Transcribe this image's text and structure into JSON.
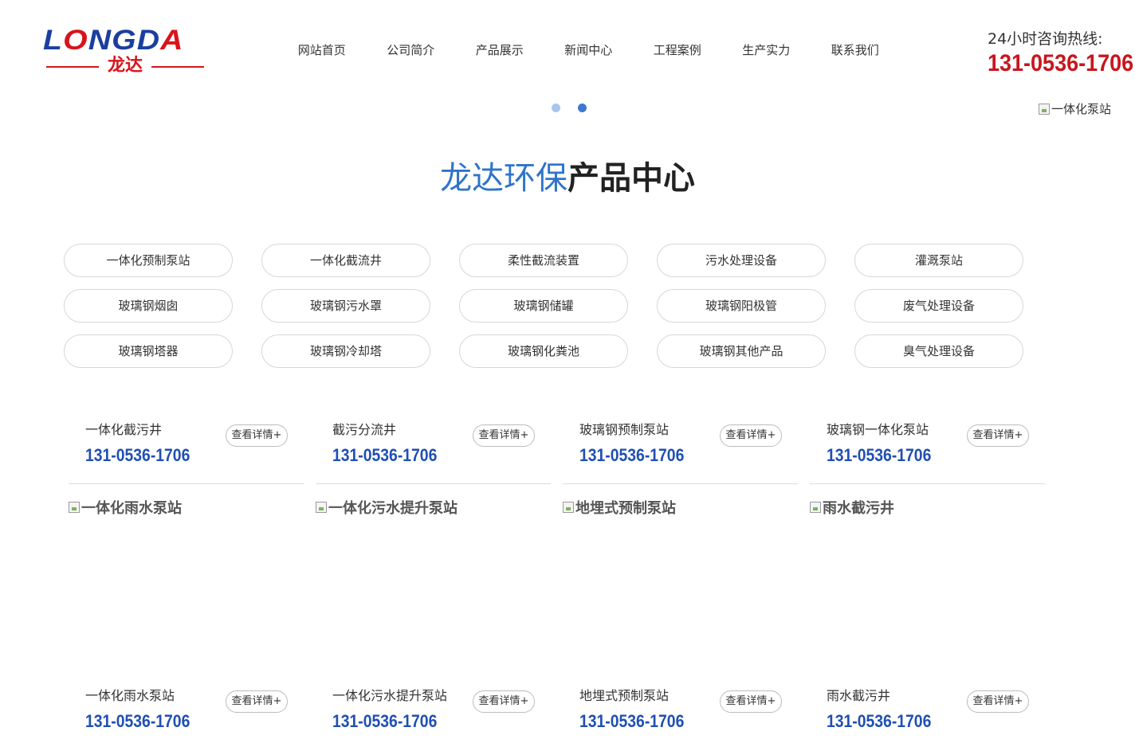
{
  "header": {
    "logo_main_a": "L",
    "logo_main_b": "O",
    "logo_main_c": "NGD",
    "logo_main_d": "A",
    "logo_sub": "龙达",
    "nav": [
      "网站首页",
      "公司简介",
      "产品展示",
      "新闻中心",
      "工程案例",
      "生产实力",
      "联系我们"
    ],
    "hotline_label": "24小时咨询热线:",
    "hotline_number": "131-0536-1706"
  },
  "banner": {
    "image_alt": "一体化泵站",
    "dots": 2,
    "active_dot": 1
  },
  "section": {
    "title_blue": "龙达环保",
    "title_dark": "产品中心"
  },
  "categories": [
    "一体化预制泵站",
    "一体化截流井",
    "柔性截流装置",
    "污水处理设备",
    "灌溉泵站",
    "玻璃钢烟囱",
    "玻璃钢污水罩",
    "玻璃钢储罐",
    "玻璃钢阳极管",
    "废气处理设备",
    "玻璃钢塔器",
    "玻璃钢冷却塔",
    "玻璃钢化粪池",
    "玻璃钢其他产品",
    "臭气处理设备"
  ],
  "products_top": [
    {
      "name": "一体化截污井",
      "tel": "131-0536-1706",
      "button": "查看详情+"
    },
    {
      "name": "截污分流井",
      "tel": "131-0536-1706",
      "button": "查看详情+"
    },
    {
      "name": "玻璃钢预制泵站",
      "tel": "131-0536-1706",
      "button": "查看详情+"
    },
    {
      "name": "玻璃钢一体化泵站",
      "tel": "131-0536-1706",
      "button": "查看详情+"
    }
  ],
  "products_bottom": [
    {
      "image_alt": "一体化雨水泵站",
      "name": "一体化雨水泵站",
      "tel": "131-0536-1706",
      "button": "查看详情+"
    },
    {
      "image_alt": "一体化污水提升泵站",
      "name": "一体化污水提升泵站",
      "tel": "131-0536-1706",
      "button": "查看详情+"
    },
    {
      "image_alt": "地埋式预制泵站",
      "name": "地埋式预制泵站",
      "tel": "131-0536-1706",
      "button": "查看详情+"
    },
    {
      "image_alt": "雨水截污井",
      "name": "雨水截污井",
      "tel": "131-0536-1706",
      "button": "查看详情+"
    }
  ]
}
